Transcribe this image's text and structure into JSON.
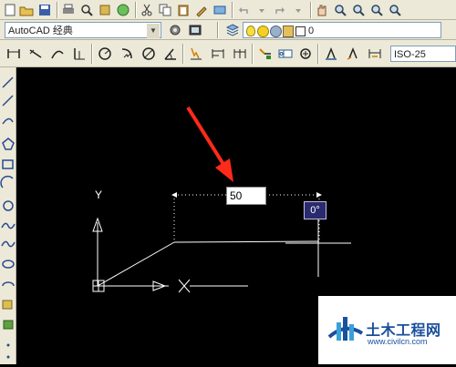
{
  "workspace": {
    "label": "AutoCAD 经典"
  },
  "layer": {
    "value": "0"
  },
  "dimstyle": {
    "value": "ISO-25"
  },
  "dynamic_input": {
    "value": "50"
  },
  "angle_tooltip": {
    "value": "0°"
  },
  "ucs": {
    "y_label": "Y"
  },
  "watermark": {
    "title": "土木工程网",
    "url": "www.civilcn.com"
  },
  "colors": {
    "accent": "#ff2a1a",
    "canvas": "#000000",
    "ucs": "#ffffff",
    "tooltip": "#2a2a6e",
    "watermark": "#1a4f9e"
  }
}
